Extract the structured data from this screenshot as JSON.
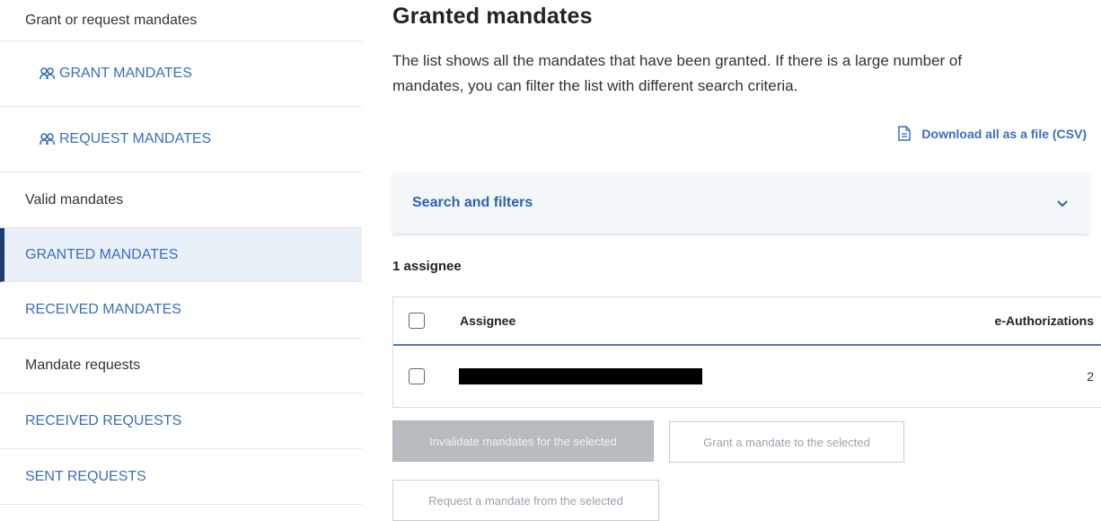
{
  "sidebar": {
    "grant_section_heading": "Grant or request mandates",
    "grant_action": "GRANT MANDATES",
    "request_action": "REQUEST MANDATES",
    "valid_heading": "Valid mandates",
    "granted_link": "GRANTED MANDATES",
    "received_link": "RECEIVED MANDATES",
    "requests_heading": "Mandate requests",
    "received_requests_link": "RECEIVED REQUESTS",
    "sent_requests_link": "SENT REQUESTS",
    "icons": {
      "people": "people-icon"
    },
    "active_item": "GRANTED MANDATES"
  },
  "main": {
    "title": "Granted mandates",
    "description": "The list shows all the mandates that have been granted. If there is a large number of mandates, you can filter the list with different search criteria.",
    "download_label": "Download all as a file (CSV)",
    "download_icon": "document-icon",
    "filters_label": "Search and filters",
    "filters_icon": "chevron-down-icon",
    "count_label": "1 assignee",
    "table": {
      "headers": {
        "assignee": "Assignee",
        "authorizations": "e-Authorizations"
      },
      "rows": [
        {
          "assignee": "",
          "authorizations": "2"
        }
      ]
    },
    "buttons": {
      "invalidate": "Invalidate mandates for the selected",
      "grant": "Grant a mandate to the selected",
      "request": "Request a mandate from the selected"
    }
  },
  "colors": {
    "link": "#3a6fbd",
    "active_bg": "#e9f0f8",
    "active_border": "#1e3d6e",
    "filters_bg": "#f4f7fa",
    "table_rule": "#4a7ac0",
    "disabled_button": "#b8bcc0"
  }
}
